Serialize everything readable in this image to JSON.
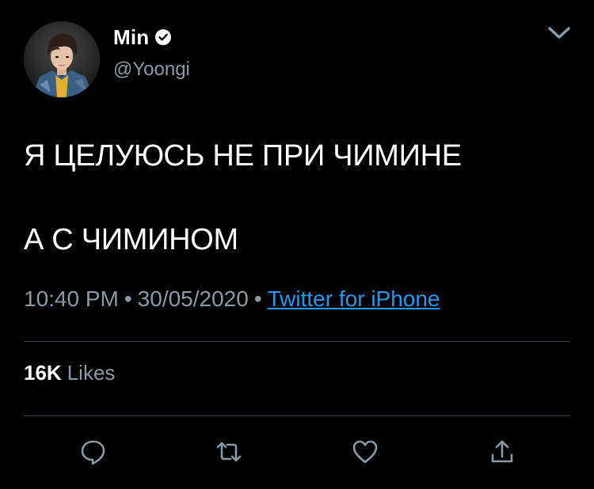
{
  "tweet": {
    "author": {
      "display_name": "Min",
      "handle": "@Yoongi",
      "verified": true
    },
    "text_lines": [
      "Я ЦЕЛУЮСЬ НЕ ПРИ ЧИМИНЕ",
      "А С ЧИМИНОМ"
    ],
    "meta": {
      "time": "10:40 PM",
      "separator": "•",
      "date": "30/05/2020",
      "source": "Twitter for iPhone"
    },
    "stats": {
      "likes_count": "16K",
      "likes_label": "Likes"
    },
    "actions": [
      {
        "icon": "reply-icon"
      },
      {
        "icon": "retweet-icon"
      },
      {
        "icon": "like-icon"
      },
      {
        "icon": "share-icon"
      }
    ],
    "menu_icon": "chevron-down-icon"
  },
  "colors": {
    "background": "#000000",
    "text_primary": "#ffffff",
    "text_secondary": "#8b98a5",
    "link": "#1d9bf0",
    "divider": "#38444d"
  }
}
